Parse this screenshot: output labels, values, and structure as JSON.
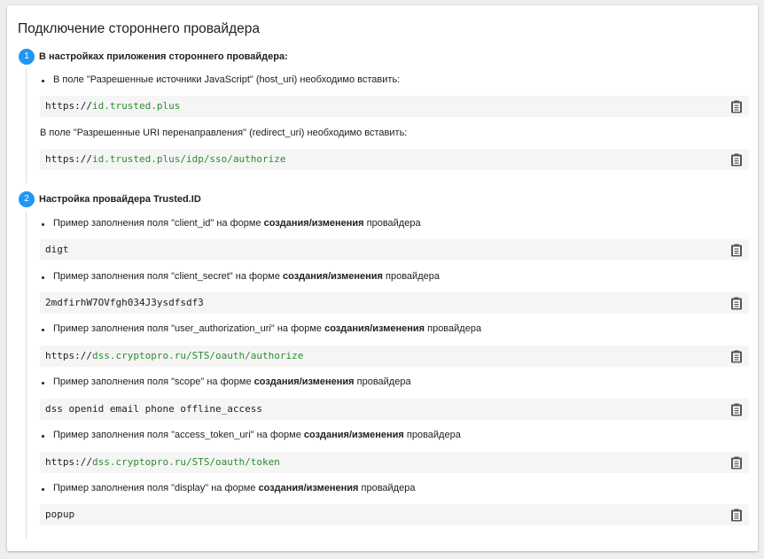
{
  "title": "Подключение стороннего провайдера",
  "steps": [
    {
      "number": "1",
      "label": "В настройках приложения стороннего провайдера:"
    },
    {
      "number": "2",
      "label": "Настройка провайдера Trusted.ID"
    }
  ],
  "section1": {
    "bullet": "В поле \"Разрешенные источники JavaScript\" (host_uri) необходимо вставить:",
    "code1": {
      "scheme": "https://",
      "rest": "id.trusted.plus"
    },
    "text2": "В поле \"Разрешенные URI перенаправления\" (redirect_uri) необходимо вставить:",
    "code2": {
      "scheme": "https://",
      "rest": "id.trusted.plus/idp/sso/authorize"
    }
  },
  "section2": {
    "items": [
      {
        "pre": "Пример заполнения поля \"client_id\" на форме ",
        "bold": "создания/изменения",
        "post": " провайдера",
        "code_plain": "digt",
        "code_scheme": "",
        "code_rest": ""
      },
      {
        "pre": "Пример заполнения поля \"client_secret\" на форме ",
        "bold": "создания/изменения",
        "post": " провайдера",
        "code_plain": "2mdfirhW7OVfgh034J3ysdfsdf3",
        "code_scheme": "",
        "code_rest": ""
      },
      {
        "pre": "Пример заполнения поля \"user_authorization_uri\" на форме ",
        "bold": "создания/изменения",
        "post": " провайдера",
        "code_plain": "",
        "code_scheme": "https://",
        "code_rest": "dss.cryptopro.ru/STS/oauth/authorize"
      },
      {
        "pre": "Пример заполнения поля \"scope\" на форме ",
        "bold": "создания/изменения",
        "post": " провайдера",
        "code_plain": "dss openid email phone offline_access",
        "code_scheme": "",
        "code_rest": ""
      },
      {
        "pre": "Пример заполнения поля \"access_token_uri\" на форме ",
        "bold": "создания/изменения",
        "post": " провайдера",
        "code_plain": "",
        "code_scheme": "https://",
        "code_rest": "dss.cryptopro.ru/STS/oauth/token"
      },
      {
        "pre": "Пример заполнения поля \"display\" на форме ",
        "bold": "создания/изменения",
        "post": " провайдера",
        "code_plain": "popup",
        "code_scheme": "",
        "code_rest": ""
      }
    ]
  },
  "icons": {
    "copy": "clipboard-icon"
  },
  "colors": {
    "accent": "#2196f3",
    "url_host": "#2e8b2e",
    "code_bg": "#f5f5f5"
  }
}
